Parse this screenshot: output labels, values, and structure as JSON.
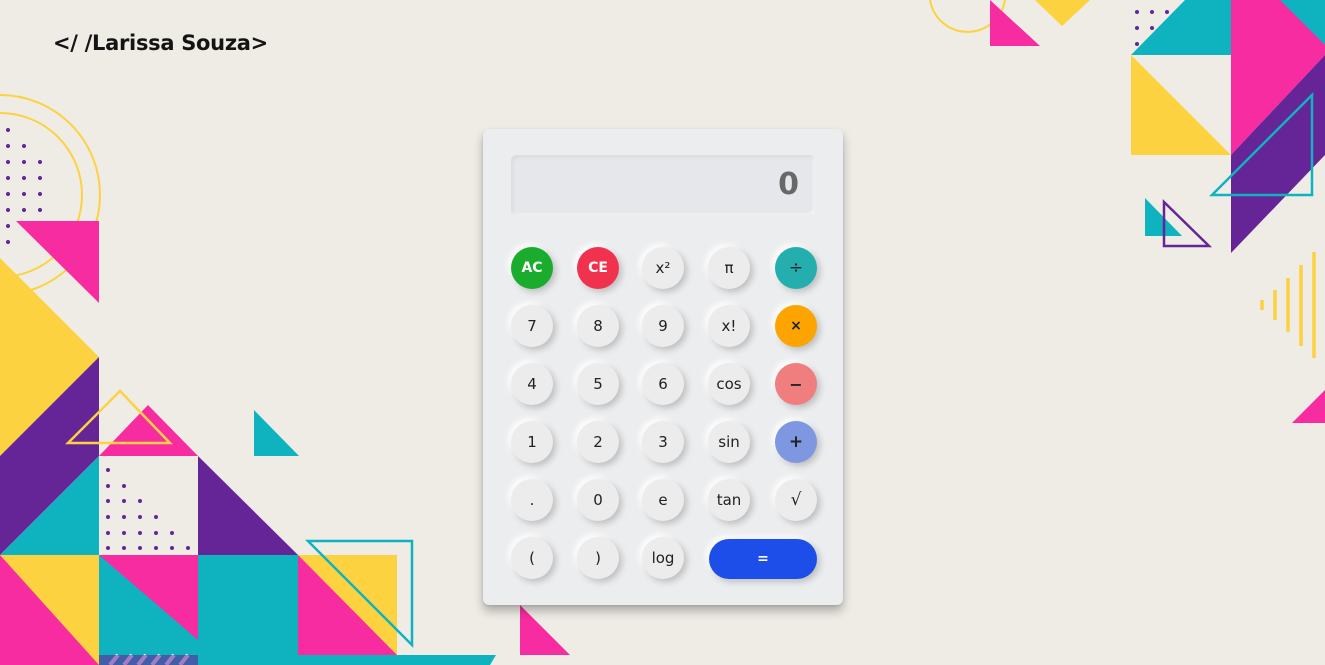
{
  "brand": {
    "text": "</ /Larissa Souza>"
  },
  "calculator": {
    "display_value": "0",
    "keys": {
      "ac": "AC",
      "ce": "CE",
      "square": "x²",
      "pi": "π",
      "divide": "÷",
      "seven": "7",
      "eight": "8",
      "nine": "9",
      "factorial": "x!",
      "multiply": "×",
      "four": "4",
      "five": "5",
      "six": "6",
      "cos": "cos",
      "subtract": "−",
      "one": "1",
      "two": "2",
      "three": "3",
      "sin": "sin",
      "add": "+",
      "decimal": ".",
      "zero": "0",
      "euler": "e",
      "tan": "tan",
      "sqrt": "√",
      "open_paren": "(",
      "close_paren": ")",
      "log": "log",
      "equals": "="
    }
  },
  "colors": {
    "background": "#efece6",
    "ac": "#1aac2c",
    "ce": "#f0324e",
    "divide": "#24aeae",
    "multiply": "#fea400",
    "subtract": "#f07e7e",
    "add": "#7f96e0",
    "equals": "#1e4eea",
    "deco_yellow": "#fcd240",
    "deco_pink": "#f72ca0",
    "deco_purple": "#662597",
    "deco_teal": "#0fb3c0"
  }
}
